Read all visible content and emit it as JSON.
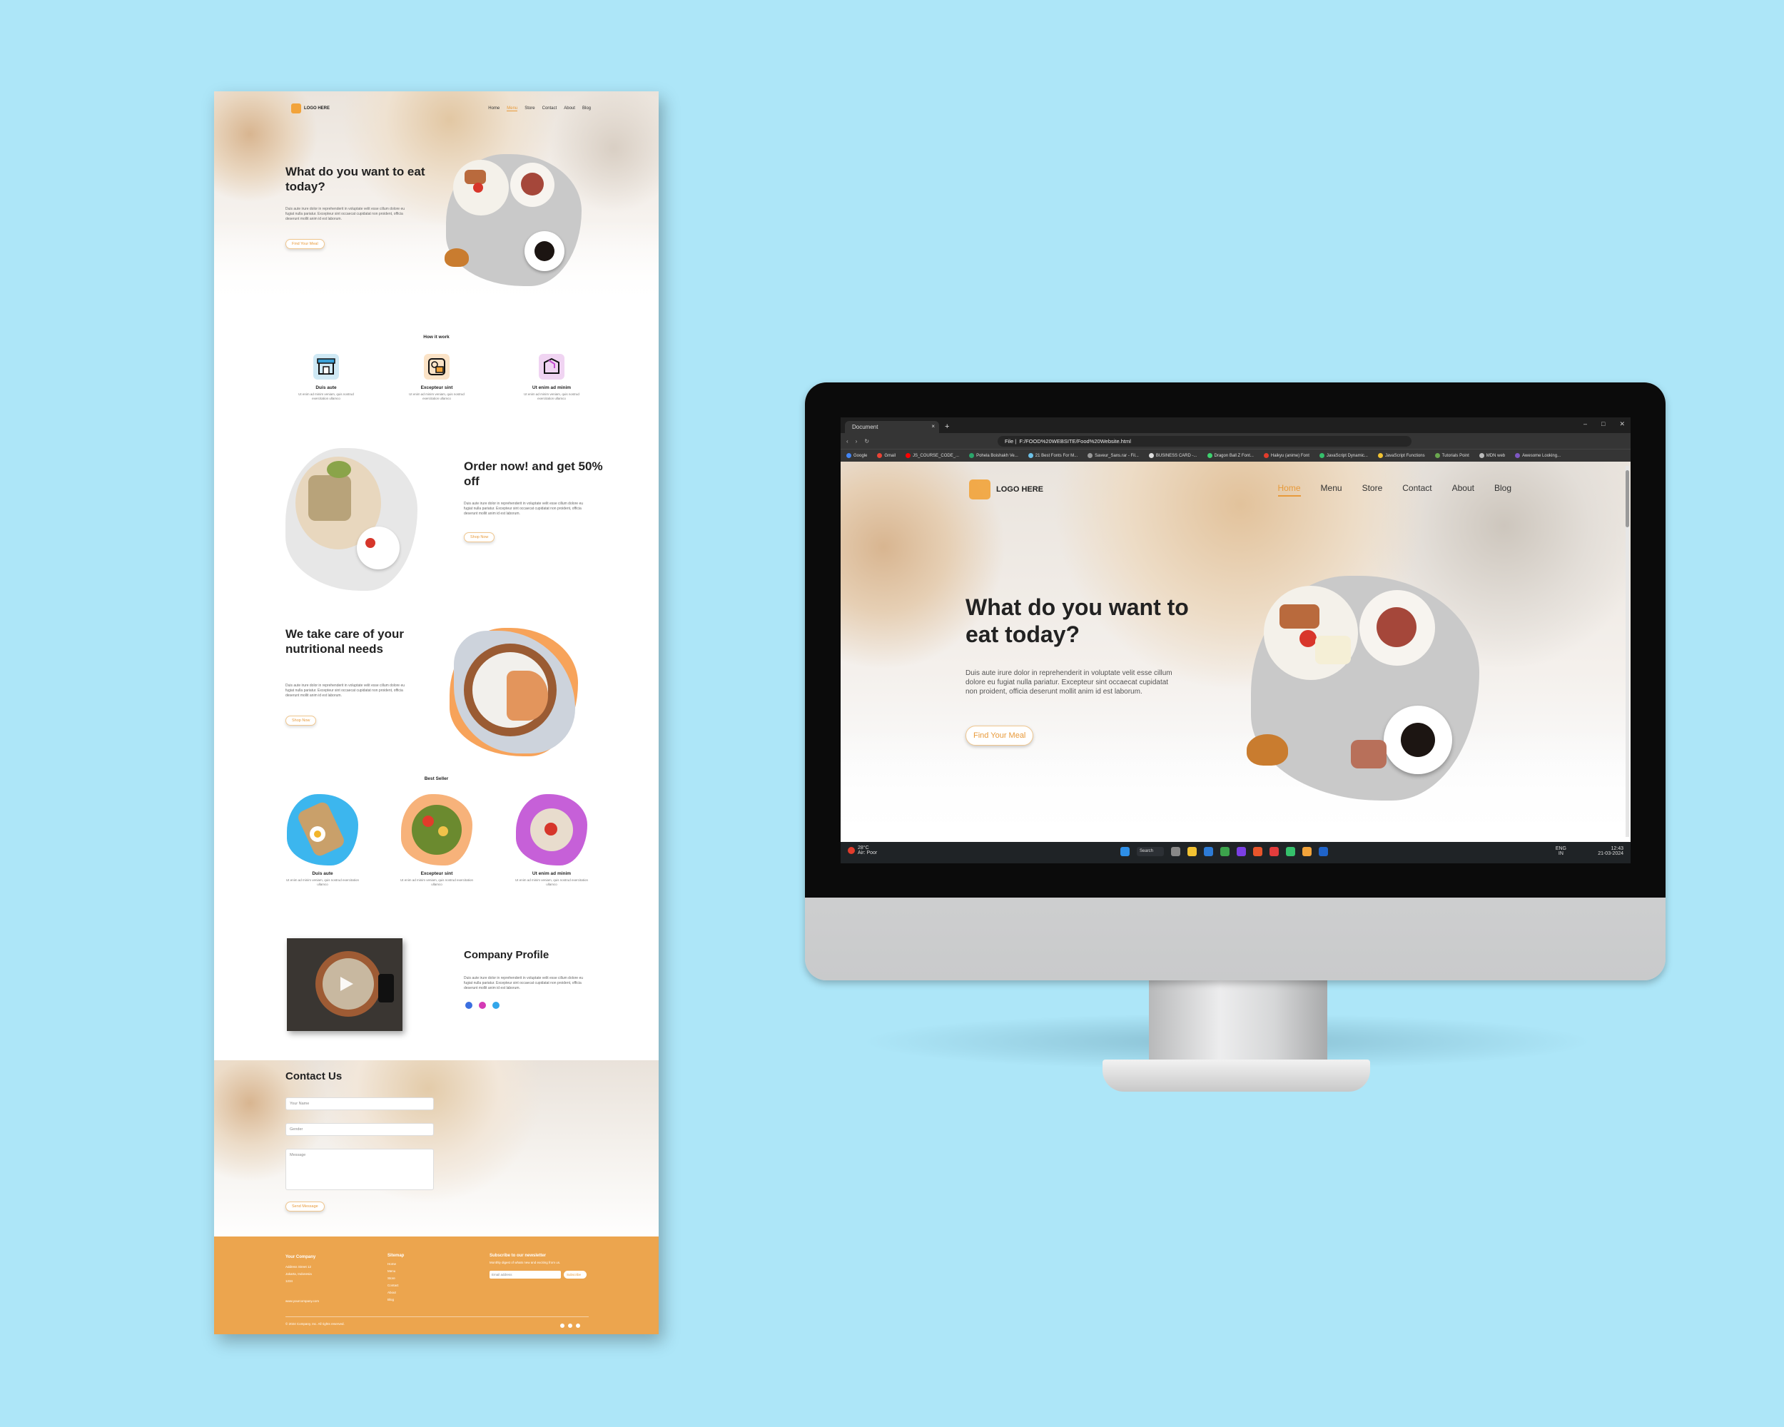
{
  "page": {
    "nav": {
      "logo": "LOGO HERE",
      "links": [
        "Home",
        "Menu",
        "Store",
        "Contact",
        "About",
        "Blog"
      ]
    },
    "hero": {
      "title": "What do you want to eat today?",
      "para": "Duis aute irure dolor in reprehenderit in voluptate velit esse cillum dolore eu fugiat nulla pariatur. Excepteur sint occaecat cupidatat non proident, officia deserunt mollit anim id est laborum.",
      "button": "Find Your Meal"
    },
    "how": {
      "label": "How it work",
      "items": [
        {
          "title": "Duis aute",
          "desc": "Ut enim ad minim veniam, quis nostrud exercitation ullamco"
        },
        {
          "title": "Excepteur sint",
          "desc": "Ut enim ad minim veniam, quis nostrud exercitation ullamco"
        },
        {
          "title": "Ut enim ad minim",
          "desc": "Ut enim ad minim veniam, quis nostrud exercitation ullamco"
        }
      ]
    },
    "order": {
      "title": "Order now! and get 50% off",
      "para": "Duis aute irure dolor in reprehenderit in voluptate velit esse cillum dolore eu fugiat nulla pariatur. Excepteur sint occaecat cupidatat non proident, officia deserunt mollit anim id est laborum.",
      "button": "Shop Now"
    },
    "care": {
      "title": "We take care of your nutritional needs",
      "para": "Duis aute irure dolor in reprehenderit in voluptate velit esse cillum dolore eu fugiat nulla pariatur. Excepteur sint occaecat cupidatat non proident, officia deserunt mollit anim id est laborum.",
      "button": "Shop Now"
    },
    "best": {
      "label": "Best Seller",
      "items": [
        {
          "title": "Duis aute",
          "desc": "Ut enim ad minim veniam, quis nostrud exercitation ullamco"
        },
        {
          "title": "Excepteur sint",
          "desc": "Ut enim ad minim veniam, quis nostrud exercitation ullamco"
        },
        {
          "title": "Ut enim ad minim",
          "desc": "Ut enim ad minim veniam, quis nostrud exercitation ullamco"
        }
      ]
    },
    "profile": {
      "title": "Company Profile",
      "para": "Duis aute irure dolor in reprehenderit in voluptate velit esse cillum dolore eu fugiat nulla pariatur. Excepteur sint occaecat cupidatat non proident, officia deserunt mollit anim id est laborum."
    },
    "contact": {
      "title": "Contact Us",
      "name": "Your Name",
      "gender": "Gender",
      "message": "Message",
      "button": "Send Message"
    },
    "footer": {
      "company": "Your Company",
      "address": [
        "Address Street 12",
        "Jakarta, Indonesia",
        "1234"
      ],
      "site": "www.yourcompany.com",
      "sitemap_title": "Sitemap",
      "sitemap": [
        "Home",
        "Menu",
        "Store",
        "Contact",
        "About",
        "Blog"
      ],
      "newsletter_title": "Subscribe to our newsletter",
      "newsletter_desc": "Monthly digest of whats new and exciting from us.",
      "email_placeholder": "Email address",
      "subscribe": "Subscribe",
      "copyright": "© 2024 Company, Inc. All rights reserved."
    }
  },
  "browser": {
    "tab": "Document",
    "tab_close": "×",
    "new_tab": "+",
    "url": "F:/FOOD%20WEBSITE/Food%20Website.html",
    "file_label": "File",
    "bookmarks": [
      "Google",
      "Gmail",
      "JS_COURSE_CODE_...",
      "Pohela Boishakh Ve...",
      "21 Best Fonts For M...",
      "Saveur_Sans.rar - Fil...",
      "BUSINESS CARD -...",
      "Dragon Ball Z Font...",
      "Haikyu (anime) Font",
      "JavaScript Dynamic...",
      "JavaScript Functions",
      "Tutorials Point",
      "MDN web",
      "Awesome Looking..."
    ],
    "site": {
      "logo": "LOGO HERE",
      "links": [
        "Home",
        "Menu",
        "Store",
        "Contact",
        "About",
        "Blog"
      ],
      "title": "What do you want to eat today?",
      "para": "Duis aute irure dolor in reprehenderit in voluptate velit esse cillum dolore eu fugiat nulla pariatur. Excepteur sint occaecat cupidatat non proident, officia deserunt mollit anim id est laborum.",
      "button": "Find Your Meal"
    },
    "taskbar": {
      "weather_temp": "28°C",
      "weather_desc": "Air: Poor",
      "search": "Search",
      "lang": "ENG",
      "region": "IN",
      "time": "12:43",
      "date": "21-03-2024"
    }
  },
  "colors": {
    "accent": "#e89a3a",
    "footer": "#eca54e",
    "background": "#ade6f8"
  }
}
